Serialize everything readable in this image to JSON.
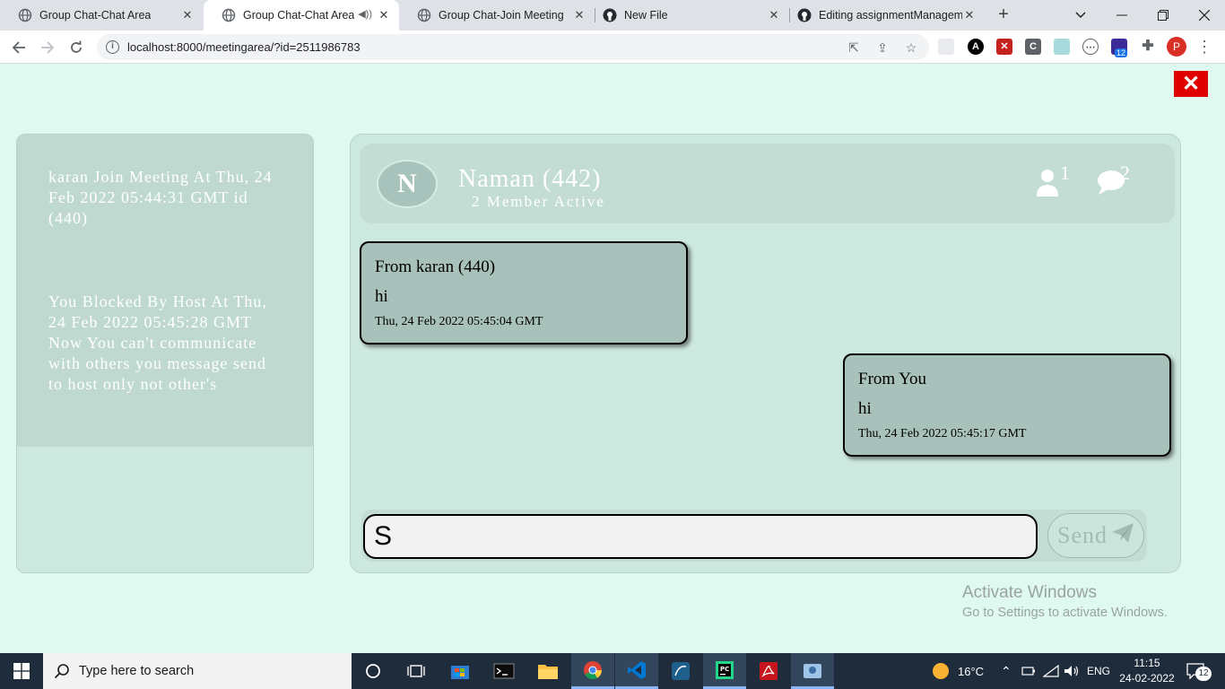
{
  "browser": {
    "tabs": [
      {
        "title": "Group Chat-Chat Area"
      },
      {
        "title": "Group Chat-Chat Area"
      },
      {
        "title": "Group Chat-Join Meeting"
      },
      {
        "title": "New File"
      },
      {
        "title": "Editing assignmentManagem"
      }
    ],
    "url": "localhost:8000/meetingarea/?id=2511986783",
    "profile_initial": "P",
    "extension_badge": "12"
  },
  "notifications": [
    {
      "text": "karan Join Meeting At Thu, 24 Feb 2022 05:44:31 GMT id (440)"
    },
    {
      "text": "You Blocked By Host At Thu, 24 Feb 2022 05:45:28 GMT Now You can't communicate with others you message send to host only not other's"
    }
  ],
  "chat": {
    "avatar_initial": "N",
    "name": "Naman (442)",
    "subtitle": "2 Member Active",
    "members_count": "1",
    "messages_count": "2",
    "messages": [
      {
        "from": "From karan (440)",
        "text": "hi",
        "time": "Thu, 24 Feb 2022 05:45:04 GMT"
      },
      {
        "from": "From You",
        "text": "hi",
        "time": "Thu, 24 Feb 2022 05:45:17 GMT"
      }
    ],
    "input_value": "S",
    "send_label": "Send"
  },
  "watermark": {
    "line1": "Activate Windows",
    "line2": "Go to Settings to activate Windows."
  },
  "taskbar": {
    "search_placeholder": "Type here to search",
    "weather": "16°C",
    "language": "ENG",
    "time": "11:15",
    "date": "24-02-2022",
    "notification_count": "12"
  },
  "colors": {
    "page_bg": "#dff9f0",
    "panel_bg": "#cde8df",
    "bubble_bg": "#a9c1bb",
    "close_red": "#e10000",
    "taskbar_bg": "#1f2c3c"
  }
}
